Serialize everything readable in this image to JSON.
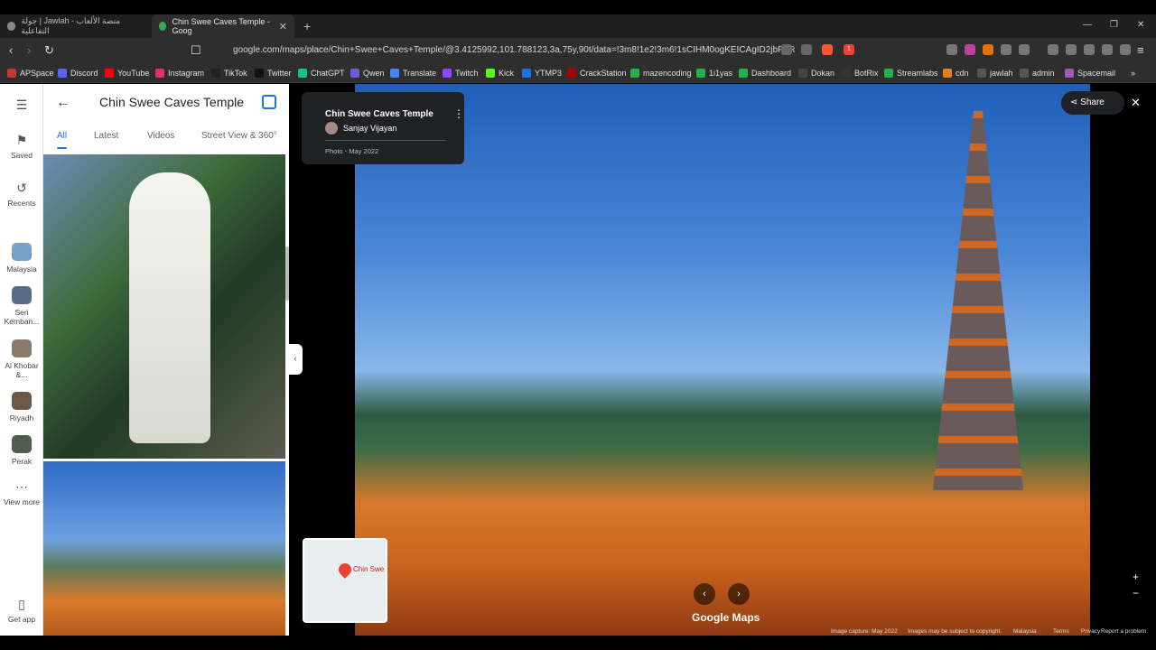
{
  "browser": {
    "tabs": [
      {
        "title": "جولة | Jawlah - منصة الألعاب التفاعلية",
        "active": false
      },
      {
        "title": "Chin Swee Caves Temple - Goog",
        "active": true
      }
    ],
    "url": "google.com/maps/place/Chin+Swee+Caves+Temple/@3.4125992,101.788123,3a,75y,90t/data=!3m8!1e2!3m6!1sCIHM0ogKEICAgID2jbPgRA!2e...",
    "bookmarks": [
      "APSpace",
      "Discord",
      "YouTube",
      "Instagram",
      "TikTok",
      "Twitter",
      "ChatGPT",
      "Qwen",
      "Translate",
      "Twitch",
      "Kick",
      "YTMP3",
      "CrackStation",
      "mazencoding",
      "1i1yas",
      "Dashboard",
      "Dokan",
      "BotRix",
      "Streamlabs",
      "cdn",
      "jawlah",
      "admin",
      "Spacemail"
    ],
    "extension_badge": "1"
  },
  "rail": {
    "saved": "Saved",
    "recents": "Recents",
    "places": [
      "Malaysia",
      "Seri Kemban...",
      "Al Khobar &...",
      "Riyadh",
      "Perak"
    ],
    "view_more": "View more",
    "get_app": "Get app"
  },
  "panel": {
    "title": "Chin Swee Caves Temple",
    "tabs": [
      "All",
      "Latest",
      "Videos",
      "Street View & 360°"
    ]
  },
  "viewer": {
    "title": "Chin Swee Caves Temple",
    "author": "Sanjay Vijayan",
    "date": "Photo - May 2022",
    "share": "Share",
    "logo": "Google Maps",
    "mini_map_label": "Chin Swe",
    "footer": [
      "Image capture: May 2022",
      "Images may be subject to copyright.",
      "Malaysia",
      "Terms",
      "Privacy",
      "Report a problem"
    ]
  }
}
